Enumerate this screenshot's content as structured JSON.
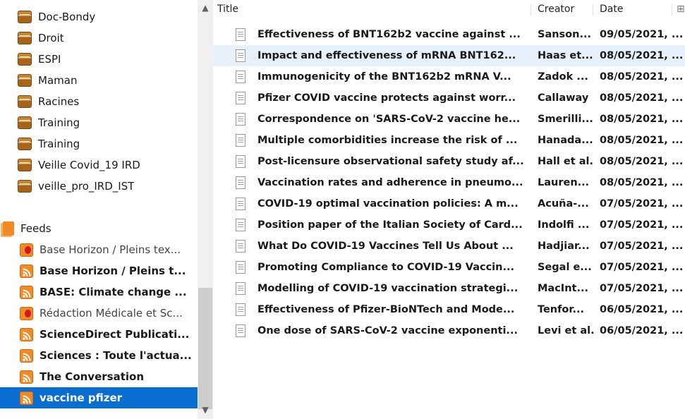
{
  "left": {
    "collections": [
      {
        "label": "Doc-Bondy"
      },
      {
        "label": "Droit"
      },
      {
        "label": "ESPI"
      },
      {
        "label": "Maman"
      },
      {
        "label": "Racines"
      },
      {
        "label": "Training"
      },
      {
        "label": "Training"
      },
      {
        "label": "Veille Covid_19 IRD"
      },
      {
        "label": "veille_pro_IRD_IST"
      }
    ],
    "feeds_header": "Feeds",
    "feeds": [
      {
        "label": "Base Horizon / Pleins tex...",
        "bold": false,
        "icon": "rss-error-icon"
      },
      {
        "label": "Base Horizon / Pleins t...",
        "bold": true,
        "icon": "rss-icon"
      },
      {
        "label": "BASE: Climate change ...",
        "bold": true,
        "icon": "rss-icon"
      },
      {
        "label": "Rédaction Médicale et Sc...",
        "bold": false,
        "icon": "rss-error-icon"
      },
      {
        "label": "ScienceDirect Publicati...",
        "bold": true,
        "icon": "rss-icon"
      },
      {
        "label": "Sciences : Toute l'actua...",
        "bold": true,
        "icon": "rss-icon"
      },
      {
        "label": "The Conversation",
        "bold": true,
        "icon": "rss-icon"
      },
      {
        "label": "vaccine pfizer",
        "bold": true,
        "icon": "rss-icon",
        "selected": true
      }
    ]
  },
  "items": {
    "headers": {
      "title": "Title",
      "creator": "Creator",
      "date": "Date",
      "extra": "⊞"
    },
    "rows": [
      {
        "title": "Effectiveness of BNT162b2 vaccine against ...",
        "creator": "Sanson...",
        "date": "09/05/2021, ..."
      },
      {
        "title": "Impact and effectiveness of mRNA BNT162...",
        "creator": "Haas et...",
        "date": "08/05/2021, ...",
        "selected": true
      },
      {
        "title": "Immunogenicity of the BNT162b2 mRNA V...",
        "creator": "Zadok ...",
        "date": "08/05/2021, ..."
      },
      {
        "title": "Pfizer COVID vaccine protects against worr...",
        "creator": "Callaway",
        "date": "08/05/2021, ..."
      },
      {
        "title": "Correspondence on 'SARS-CoV-2 vaccine he...",
        "creator": "Smerilli...",
        "date": "08/05/2021, ..."
      },
      {
        "title": "Multiple comorbidities increase the risk of ...",
        "creator": "Hanada...",
        "date": "08/05/2021, ..."
      },
      {
        "title": "Post-licensure observational safety study af...",
        "creator": "Hall et al.",
        "date": "08/05/2021, ..."
      },
      {
        "title": "Vaccination rates and adherence in pneumo...",
        "creator": "Lauren...",
        "date": "08/05/2021, ..."
      },
      {
        "title": "COVID-19 optimal vaccination policies: A m...",
        "creator": "Acuña-...",
        "date": "07/05/2021, ..."
      },
      {
        "title": "Position paper of the Italian Society of Card...",
        "creator": "Indolfi ...",
        "date": "07/05/2021, ..."
      },
      {
        "title": "What Do COVID-19 Vaccines Tell Us About ...",
        "creator": "Hadjiar...",
        "date": "07/05/2021, ..."
      },
      {
        "title": "Promoting Compliance to COVID-19 Vaccin...",
        "creator": "Segal e...",
        "date": "07/05/2021, ..."
      },
      {
        "title": "Modelling of COVID-19 vaccination strategi...",
        "creator": "MacInt...",
        "date": "07/05/2021, ..."
      },
      {
        "title": "Effectiveness of Pfizer-BioNTech and Mode...",
        "creator": "Tenfor...",
        "date": "06/05/2021, ..."
      },
      {
        "title": "One dose of SARS-CoV-2 vaccine exponenti...",
        "creator": "Levi et al.",
        "date": "06/05/2021, ..."
      }
    ]
  },
  "colors": {
    "selection": "#0a6ed1",
    "row_highlight": "#e7f1fb",
    "rss": "#f28a25"
  }
}
